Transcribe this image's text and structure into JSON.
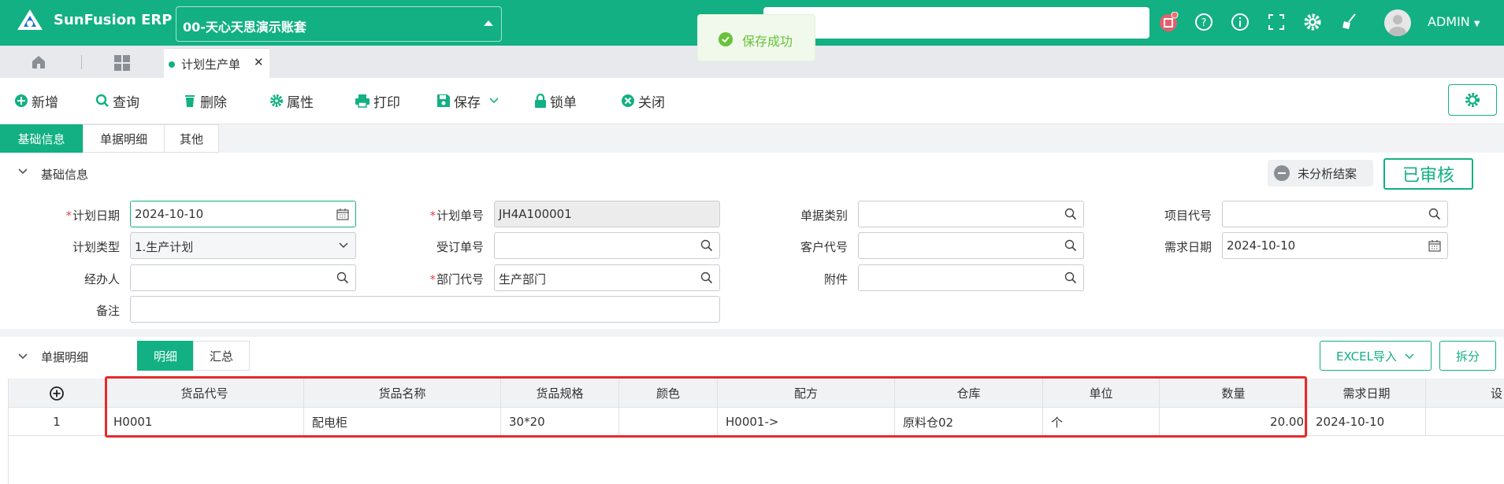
{
  "app": {
    "brand": "SunFusion ERP",
    "account": "00-天心天思演示账套",
    "user": "ADMIN"
  },
  "toast": {
    "message": "保存成功"
  },
  "tabs": {
    "active_label": "计划生产单"
  },
  "toolbar": {
    "new": "新增",
    "query": "查询",
    "delete": "删除",
    "properties": "属性",
    "print": "打印",
    "save": "保存",
    "lock": "锁单",
    "close": "关闭"
  },
  "section_tabs": [
    "基础信息",
    "单据明细",
    "其他"
  ],
  "base_info": {
    "title": "基础信息",
    "status_unanalyzed": "未分析结案",
    "status_approved": "已审核",
    "fields": {
      "plan_date": {
        "label": "计划日期",
        "value": "2024-10-10"
      },
      "plan_no": {
        "label": "计划单号",
        "value": "JH4A100001"
      },
      "doc_type": {
        "label": "单据类别",
        "value": ""
      },
      "project_code": {
        "label": "项目代号",
        "value": ""
      },
      "plan_type": {
        "label": "计划类型",
        "value": "1.生产计划"
      },
      "order_no": {
        "label": "受订单号",
        "value": ""
      },
      "customer_code": {
        "label": "客户代号",
        "value": ""
      },
      "demand_date": {
        "label": "需求日期",
        "value": "2024-10-10"
      },
      "handler": {
        "label": "经办人",
        "value": ""
      },
      "dept_code": {
        "label": "部门代号",
        "value": "生产部门"
      },
      "attachment": {
        "label": "附件",
        "value": ""
      },
      "remark": {
        "label": "备注",
        "value": ""
      }
    }
  },
  "detail": {
    "title": "单据明细",
    "seg_detail": "明细",
    "seg_summary": "汇总",
    "excel_import": "EXCEL导入",
    "split": "拆分",
    "columns": [
      "货品代号",
      "货品名称",
      "货品规格",
      "颜色",
      "配方",
      "仓库",
      "单位",
      "数量",
      "需求日期",
      "设"
    ],
    "rows": [
      {
        "index": "1",
        "code": "H0001",
        "name": "配电柜",
        "spec": "30*20",
        "color": "",
        "formula": "H0001->",
        "warehouse": "原料仓02",
        "unit": "个",
        "qty": "20.00",
        "demand_date": "2024-10-10"
      }
    ]
  },
  "colors": {
    "primary": "#12b083",
    "highlight": "#e42b2b"
  }
}
